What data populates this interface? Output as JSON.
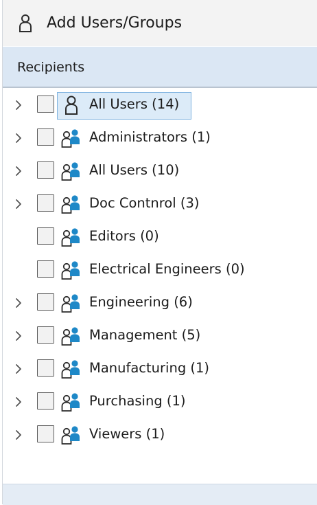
{
  "title": "Add Users/Groups",
  "header": {
    "label": "Recipients"
  },
  "colors": {
    "header_bg": "#dbe7f4",
    "selection_bg": "#dcebf8",
    "selection_border": "#7fb3e0",
    "group_icon_blue": "#1e88c7"
  },
  "tree": {
    "items": [
      {
        "label": "All Users (14)",
        "icon": "user-icon",
        "expandable": true,
        "selected": true
      },
      {
        "label": "Administrators (1)",
        "icon": "group-icon",
        "expandable": true,
        "selected": false
      },
      {
        "label": "All Users (10)",
        "icon": "group-icon",
        "expandable": true,
        "selected": false
      },
      {
        "label": "Doc Contnrol (3)",
        "icon": "group-icon",
        "expandable": true,
        "selected": false
      },
      {
        "label": "Editors (0)",
        "icon": "group-icon",
        "expandable": false,
        "selected": false
      },
      {
        "label": "Electrical Engineers (0)",
        "icon": "group-icon",
        "expandable": false,
        "selected": false
      },
      {
        "label": "Engineering (6)",
        "icon": "group-icon",
        "expandable": true,
        "selected": false
      },
      {
        "label": "Management (5)",
        "icon": "group-icon",
        "expandable": true,
        "selected": false
      },
      {
        "label": "Manufacturing (1)",
        "icon": "group-icon",
        "expandable": true,
        "selected": false
      },
      {
        "label": "Purchasing (1)",
        "icon": "group-icon",
        "expandable": true,
        "selected": false
      },
      {
        "label": "Viewers (1)",
        "icon": "group-icon",
        "expandable": true,
        "selected": false
      }
    ]
  }
}
